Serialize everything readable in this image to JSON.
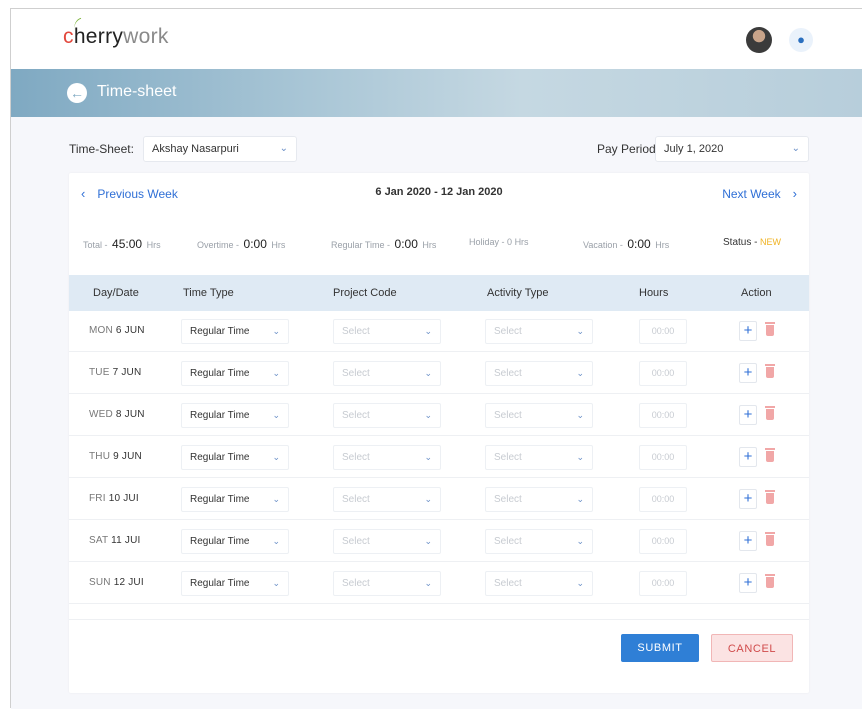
{
  "app": {
    "logo_text_1": "c",
    "logo_text_2": "herry",
    "logo_text_3": "work",
    "page_title": "Time-sheet"
  },
  "filters": {
    "timesheet_label": "Time-Sheet:",
    "timesheet_value": "Akshay Nasarpuri",
    "pay_period_label": "Pay Period:",
    "pay_period_value": "July 1, 2020"
  },
  "week": {
    "previous_label": "Previous Week",
    "range": "6 Jan 2020 - 12 Jan 2020",
    "next_label": "Next Week"
  },
  "summary": {
    "total_label": "Total -",
    "total_value": "45:00",
    "overtime_label": "Overtime -",
    "overtime_value": "0:00",
    "regular_label": "Regular Time -",
    "regular_value": "0:00",
    "holiday_label": "Holiday -",
    "holiday_value": "0",
    "vacation_label": "Vacation -",
    "vacation_value": "0:00",
    "hrs_unit": "Hrs",
    "status_label": "Status -",
    "status_value": "NEW"
  },
  "table": {
    "headers": [
      "Day/Date",
      "Time Type",
      "Project Code",
      "Activity Type",
      "Hours",
      "Action"
    ],
    "select_placeholder": "Select",
    "hours_placeholder": "00:00",
    "rows": [
      {
        "dow": "MON",
        "date": "6 JUN",
        "time_type": "Regular Time"
      },
      {
        "dow": "TUE",
        "date": "7 JUN",
        "time_type": "Regular Time"
      },
      {
        "dow": "WED",
        "date": "8 JUN",
        "time_type": "Regular Time"
      },
      {
        "dow": "THU",
        "date": "9 JUN",
        "time_type": "Regular Time"
      },
      {
        "dow": "FRI",
        "date": "10 JUI",
        "time_type": "Regular Time"
      },
      {
        "dow": "SAT",
        "date": "11 JUI",
        "time_type": "Regular Time"
      },
      {
        "dow": "SUN",
        "date": "12 JUI",
        "time_type": "Regular Time"
      }
    ]
  },
  "actions": {
    "submit_label": "SUBMIT",
    "cancel_label": "CANCEL"
  },
  "icons": [
    "back-arrow-icon",
    "chevron-down-icon",
    "chevron-left-icon",
    "chevron-right-icon",
    "plus-icon",
    "trash-icon",
    "location-pin-icon",
    "avatar"
  ],
  "colors": {
    "accent": "#2f6fd6",
    "submit_bg": "#2f7fd6",
    "cancel_bg": "#fbe3e3",
    "header_band": "#dfeaf4",
    "status_new": "#f0b323"
  }
}
